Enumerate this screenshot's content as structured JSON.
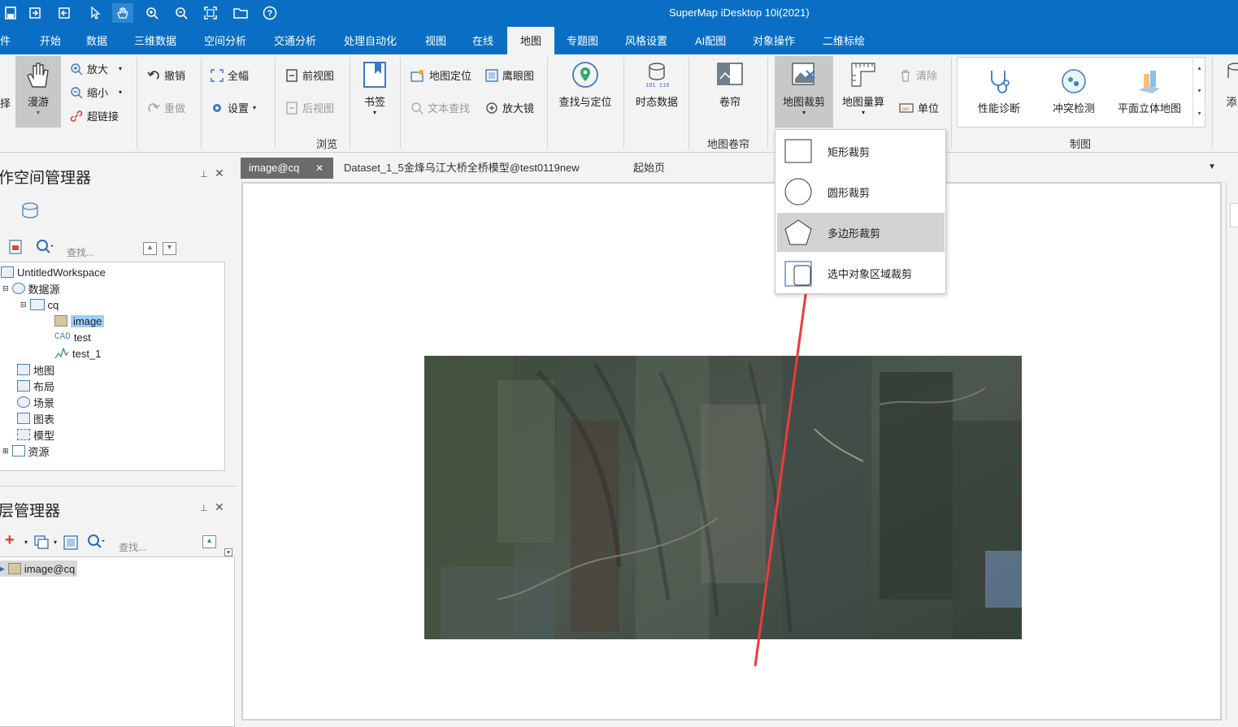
{
  "app": {
    "title": "SuperMap iDesktop 10i(2021)"
  },
  "menu": {
    "items": [
      "件",
      "开始",
      "数据",
      "三维数据",
      "空间分析",
      "交通分析",
      "处理自动化",
      "视图",
      "在线",
      "地图",
      "专题图",
      "风格设置",
      "AI配图",
      "对象操作",
      "二维标绘"
    ],
    "active": "地图"
  },
  "ribbon": {
    "roam": "漫游",
    "zoom_in": "放大",
    "zoom_out": "缩小",
    "hyperlink": "超链接",
    "undo": "撤销",
    "redo": "重做",
    "full_extent": "全幅",
    "settings": "设置",
    "prev_view": "前视图",
    "next_view": "后视图",
    "bookmark": "书签",
    "map_locate": "地图定位",
    "eagle_eye": "鹰眼图",
    "text_find": "文本查找",
    "magnifier": "放大镜",
    "find_locate": "查找与定位",
    "temporal": "时态数据",
    "browse_group": "浏览",
    "swipe": "卷帘",
    "swipe_group": "地图卷帘",
    "map_clip": "地图裁剪",
    "map_measure": "地图量算",
    "clear": "清除",
    "unit": "单位",
    "perf_diag": "性能诊断",
    "conflict_check": "冲突检测",
    "plane_3d": "平面立体地图",
    "cartography_group": "制图",
    "add_partial": "添"
  },
  "clip_menu": {
    "items": [
      "矩形裁剪",
      "圆形裁剪",
      "多边形裁剪",
      "选中对象区域裁剪"
    ],
    "highlighted": "多边形裁剪"
  },
  "workspace_panel": {
    "title": "作空间管理器",
    "search_placeholder": "查找...",
    "tree": {
      "root": "UntitledWorkspace",
      "datasources": "数据源",
      "cq": "cq",
      "image": "image",
      "test": "test",
      "test_1": "test_1",
      "maps": "地图",
      "layouts": "布局",
      "scenes": "场景",
      "charts": "图表",
      "models": "模型",
      "resources": "资源"
    }
  },
  "layer_panel": {
    "title": "层管理器",
    "search_placeholder": "查找...",
    "layer": "image@cq"
  },
  "doc_tabs": {
    "tab1": "image@cq",
    "tab2": "Dataset_1_5金烽乌江大桥全桥模型@test0119new",
    "tab3": "起始页"
  },
  "colors": {
    "title_bar": "#0a6fc4",
    "annotation_arrow": "#f03a3a",
    "selection": "#99cfff"
  }
}
